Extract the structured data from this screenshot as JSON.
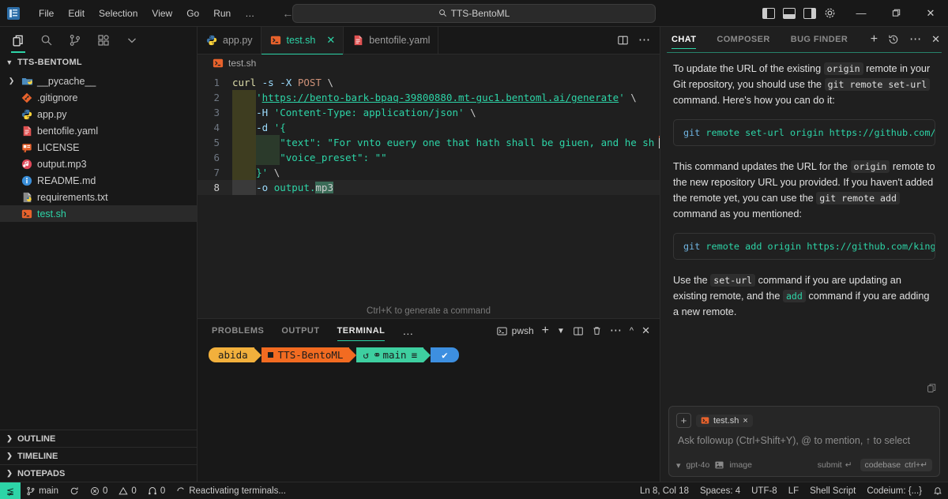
{
  "titlebar": {
    "logo": "cursor-logo-icon",
    "menus": [
      "File",
      "Edit",
      "Selection",
      "View",
      "Go",
      "Run",
      "…"
    ],
    "nav_back": "←",
    "nav_forward": "→",
    "search": {
      "icon": "search-icon",
      "value": "TTS-BentoML"
    },
    "layout_icons": [
      "toggle-primary-sidebar-icon",
      "toggle-panel-icon",
      "toggle-secondary-sidebar-icon",
      "settings-gear-icon"
    ],
    "window_controls": {
      "minimize": "—",
      "maximize": "❐",
      "close": "✕"
    }
  },
  "sidebar": {
    "activity_icons": [
      "explorer-icon",
      "search-icon",
      "source-control-icon",
      "extensions-icon",
      "chevron-down-icon"
    ],
    "title": "TTS-BENTOML",
    "files": [
      {
        "name": "__pycache__",
        "icon": "folder-python-icon",
        "type": "folder",
        "expandable": true,
        "selected": false
      },
      {
        "name": ".gitignore",
        "icon": "git-icon",
        "type": "file",
        "expandable": false,
        "selected": false
      },
      {
        "name": "app.py",
        "icon": "python-icon",
        "type": "file",
        "expandable": false,
        "selected": false
      },
      {
        "name": "bentofile.yaml",
        "icon": "yaml-icon",
        "type": "file",
        "expandable": false,
        "selected": false
      },
      {
        "name": "LICENSE",
        "icon": "license-icon",
        "type": "file",
        "expandable": false,
        "selected": false
      },
      {
        "name": "output.mp3",
        "icon": "audio-icon",
        "type": "file",
        "expandable": false,
        "selected": false
      },
      {
        "name": "README.md",
        "icon": "markdown-info-icon",
        "type": "file",
        "expandable": false,
        "selected": false
      },
      {
        "name": "requirements.txt",
        "icon": "requirements-icon",
        "type": "file",
        "expandable": false,
        "selected": false
      },
      {
        "name": "test.sh",
        "icon": "shell-icon",
        "type": "file",
        "expandable": false,
        "selected": true
      }
    ],
    "sections": [
      "OUTLINE",
      "TIMELINE",
      "NOTEPADS"
    ]
  },
  "editor": {
    "tabs": [
      {
        "label": "app.py",
        "icon": "python-icon",
        "active": false,
        "closable": false
      },
      {
        "label": "test.sh",
        "icon": "shell-icon",
        "active": true,
        "closable": true
      },
      {
        "label": "bentofile.yaml",
        "icon": "yaml-icon",
        "active": false,
        "closable": false
      }
    ],
    "tab_actions": [
      "split-editor-icon",
      "more-actions-icon"
    ],
    "breadcrumb": {
      "icon": "shell-icon",
      "label": "test.sh"
    },
    "generate_hint": "Ctrl+K to generate a command",
    "lines": [
      {
        "n": "1",
        "segments": [
          {
            "t": "curl",
            "c": "fn"
          },
          {
            "t": " ",
            "c": "pl"
          },
          {
            "t": "-s",
            "c": "kw"
          },
          {
            "t": " ",
            "c": "pl"
          },
          {
            "t": "-X",
            "c": "kw"
          },
          {
            "t": " ",
            "c": "pl"
          },
          {
            "t": "POST",
            "c": "par"
          },
          {
            "t": " ",
            "c": "pl"
          },
          {
            "t": "\\",
            "c": "pl"
          }
        ]
      },
      {
        "n": "2",
        "indent": [
          {
            "w": 4,
            "g": "ig1"
          }
        ],
        "segments": [
          {
            "t": "'",
            "c": "str"
          },
          {
            "t": "https://bento-bark-bpaq-39800880.mt-guc1.bentoml.ai/generate",
            "c": "url"
          },
          {
            "t": "'",
            "c": "str"
          },
          {
            "t": " ",
            "c": "pl"
          },
          {
            "t": "\\",
            "c": "pl"
          }
        ]
      },
      {
        "n": "3",
        "indent": [
          {
            "w": 4,
            "g": "ig1"
          }
        ],
        "segments": [
          {
            "t": "-H",
            "c": "kw"
          },
          {
            "t": " ",
            "c": "pl"
          },
          {
            "t": "'Content-Type: application/json'",
            "c": "str"
          },
          {
            "t": " ",
            "c": "pl"
          },
          {
            "t": "\\",
            "c": "pl"
          }
        ]
      },
      {
        "n": "4",
        "indent": [
          {
            "w": 4,
            "g": "ig1"
          }
        ],
        "segments": [
          {
            "t": "-d",
            "c": "kw"
          },
          {
            "t": " ",
            "c": "pl"
          },
          {
            "t": "'{",
            "c": "str"
          }
        ]
      },
      {
        "n": "5",
        "indent": [
          {
            "w": 4,
            "g": "ig1"
          },
          {
            "w": 4,
            "g": "ig2"
          }
        ],
        "segments": [
          {
            "t": "\"text\": \"For vnto euery one that hath shall be giuen, and he sh",
            "c": "str"
          }
        ],
        "caret_end": true
      },
      {
        "n": "6",
        "indent": [
          {
            "w": 4,
            "g": "ig1"
          },
          {
            "w": 4,
            "g": "ig2"
          }
        ],
        "segments": [
          {
            "t": "\"voice_preset\": \"\"",
            "c": "str"
          }
        ]
      },
      {
        "n": "7",
        "indent": [
          {
            "w": 4,
            "g": "ig1"
          }
        ],
        "segments": [
          {
            "t": "}'",
            "c": "str"
          },
          {
            "t": " ",
            "c": "pl"
          },
          {
            "t": "\\",
            "c": "pl"
          }
        ]
      },
      {
        "n": "8",
        "current": true,
        "indent": [
          {
            "w": 4,
            "g": "ig3"
          }
        ],
        "segments": [
          {
            "t": "-o",
            "c": "kw"
          },
          {
            "t": " ",
            "c": "pl"
          },
          {
            "t": "output.",
            "c": "str"
          },
          {
            "t": "mp3",
            "c": "sel"
          }
        ]
      }
    ]
  },
  "panel": {
    "tabs": [
      "PROBLEMS",
      "OUTPUT",
      "TERMINAL"
    ],
    "active_tab": "TERMINAL",
    "more": "…",
    "shell_label": "pwsh",
    "actions": [
      "new-terminal-icon",
      "chevron-down-icon",
      "split-terminal-icon",
      "kill-terminal-icon",
      "more-actions-icon",
      "maximize-panel-icon",
      "close-panel-icon"
    ],
    "prompt": {
      "user": "abida",
      "folder": "TTS-BentoML",
      "branch": "main",
      "branch_extra": "≡",
      "status": "✔",
      "colors": {
        "user": "#f2b03c",
        "folder": "#f26b21",
        "branch": "#3ecfa0",
        "status": "#3d8fe0"
      }
    }
  },
  "chat": {
    "tabs": [
      "CHAT",
      "COMPOSER",
      "BUG FINDER"
    ],
    "active_tab": "CHAT",
    "actions": [
      "new-chat-icon",
      "history-icon",
      "more-actions-icon",
      "close-icon"
    ],
    "messages": [
      {
        "type": "paragraph",
        "parts": [
          {
            "t": "To update the URL of the existing ",
            "k": "text"
          },
          {
            "t": "origin",
            "k": "code"
          },
          {
            "t": " remote in your Git repository, you should use the ",
            "k": "text"
          },
          {
            "t": "git remote set-url",
            "k": "code"
          },
          {
            "t": " command. Here's how you can do it:",
            "k": "text"
          }
        ]
      },
      {
        "type": "code",
        "text": "git remote set-url origin https://github.com/kinga",
        "kw": "git"
      },
      {
        "type": "paragraph",
        "parts": [
          {
            "t": "This command updates the URL for the ",
            "k": "text"
          },
          {
            "t": "origin",
            "k": "code"
          },
          {
            "t": " remote to the new repository URL you provided. If you haven't added the remote yet, you can use the ",
            "k": "text"
          },
          {
            "t": "git remote add",
            "k": "code"
          },
          {
            "t": " command as you mentioned:",
            "k": "text"
          }
        ]
      },
      {
        "type": "code",
        "text": "git remote add origin https://github.com/kingabzpr",
        "kw": "git"
      },
      {
        "type": "paragraph",
        "parts": [
          {
            "t": "Use the ",
            "k": "text"
          },
          {
            "t": "set-url",
            "k": "code"
          },
          {
            "t": " command if you are updating an existing remote, and the ",
            "k": "text"
          },
          {
            "t": "add",
            "k": "code-teal"
          },
          {
            "t": " command if you are adding a new remote.",
            "k": "text"
          }
        ]
      }
    ],
    "copy_icon": "copy-icon",
    "input": {
      "add_context": "+",
      "context_chip": {
        "label": "test.sh",
        "icon": "shell-icon",
        "close": "×"
      },
      "placeholder": "Ask followup (Ctrl+Shift+Y), @ to mention, ↑ to select",
      "model": "gpt-4o",
      "model_chevron": "⌄",
      "image_label": "image",
      "image_icon": "image-icon",
      "submit_label": "submit",
      "submit_key": "↵",
      "codebase_label": "codebase",
      "codebase_key": "ctrl+↵"
    }
  },
  "statusbar": {
    "remote_icon": "remote-window-icon",
    "left": [
      {
        "icon": "source-control-icon",
        "label": "main"
      },
      {
        "icon": "sync-icon",
        "label": ""
      },
      {
        "icon": "error-icon",
        "label": "0"
      },
      {
        "icon": "warning-icon",
        "label": "0"
      },
      {
        "icon": "ports-icon",
        "label": "0"
      },
      {
        "icon": "loading-icon",
        "label": "Reactivating terminals..."
      }
    ],
    "right": [
      {
        "label": "Ln 8, Col 18"
      },
      {
        "label": "Spaces: 4"
      },
      {
        "label": "UTF-8"
      },
      {
        "label": "LF"
      },
      {
        "label": "Shell Script"
      },
      {
        "label": "Codeium: {...}"
      },
      {
        "icon": "bell-icon",
        "label": ""
      }
    ]
  }
}
